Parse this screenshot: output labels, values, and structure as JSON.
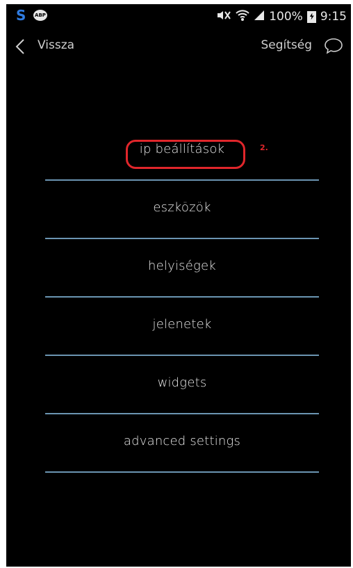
{
  "status_bar": {
    "app_icons": [
      "skype-icon",
      "adblock-icon"
    ],
    "abp_text": "ABP",
    "battery": "100%",
    "time": "9:15"
  },
  "action_bar": {
    "back_label": "Vissza",
    "help_label": "Segítség"
  },
  "menu": {
    "items": [
      {
        "label": "ip beállítások"
      },
      {
        "label": "eszközök"
      },
      {
        "label": "helyiségek"
      },
      {
        "label": "jelenetek"
      },
      {
        "label": "widgets"
      },
      {
        "label": "advanced settings"
      }
    ]
  },
  "annotation": {
    "step_label": "2.",
    "color": "#e0262b"
  },
  "colors": {
    "background": "#000000",
    "divider": "#6b95b2"
  }
}
